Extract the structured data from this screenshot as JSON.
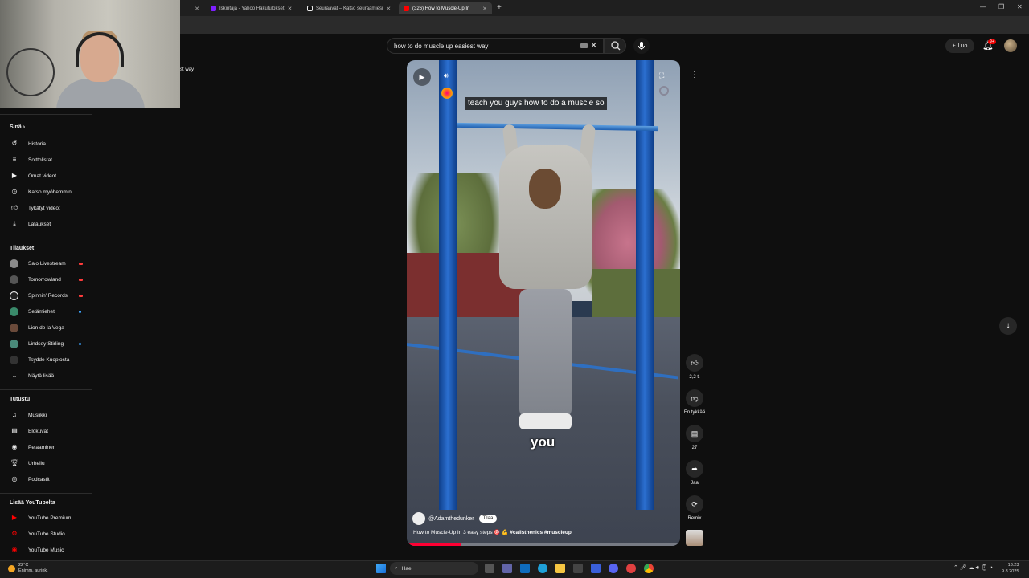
{
  "browser": {
    "tabs": [
      {
        "label": "...",
        "active": false
      },
      {
        "label": "Iskintäjä - Yahoo Hakutulokset",
        "active": false
      },
      {
        "label": "Seuraavat – Katso seuraamiesi",
        "active": false
      },
      {
        "label": "(326) How to Muscle-Up In",
        "active": true
      }
    ],
    "new_tab": "+"
  },
  "search": {
    "value": "how to do muscle up easiest way",
    "clear_label": "✕"
  },
  "header": {
    "create_label": "Luo",
    "notifications_badge": "9+"
  },
  "webcam_overlay_text": "st way",
  "sidebar": {
    "you_title": "Sinä",
    "you_items": [
      {
        "icon": "history-icon",
        "label": "Historia"
      },
      {
        "icon": "playlist-icon",
        "label": "Soittolistat"
      },
      {
        "icon": "your-videos-icon",
        "label": "Omat videot"
      },
      {
        "icon": "watch-later-icon",
        "label": "Katso myöhemmin"
      },
      {
        "icon": "liked-icon",
        "label": "Tykätyt videot"
      },
      {
        "icon": "download-icon",
        "label": "Lataukset"
      }
    ],
    "subs_title": "Tilaukset",
    "subs_items": [
      {
        "label": "Salo Livestream",
        "indicator": "live",
        "color": "#8a8a8a"
      },
      {
        "label": "Tomorrowland",
        "indicator": "live",
        "color": "#555"
      },
      {
        "label": "Spinnin' Records",
        "indicator": "live",
        "color": "#222"
      },
      {
        "label": "Setämiehet",
        "indicator": "dot",
        "color": "#3a8a6a"
      },
      {
        "label": "Lion de la Vega",
        "indicator": "",
        "color": "#6a4a3a"
      },
      {
        "label": "Lindsey Stirling",
        "indicator": "dot",
        "color": "#4a8a7a"
      },
      {
        "label": "Tsydde Kuopiosta",
        "indicator": "",
        "color": "#333"
      }
    ],
    "show_more": "Näytä lisää",
    "explore_title": "Tutustu",
    "explore_items": [
      {
        "icon": "music-icon",
        "label": "Musiikki"
      },
      {
        "icon": "movies-icon",
        "label": "Elokuvat"
      },
      {
        "icon": "gaming-icon",
        "label": "Pelaaminen"
      },
      {
        "icon": "sports-icon",
        "label": "Urheilu"
      },
      {
        "icon": "podcast-icon",
        "label": "Podcastit"
      }
    ],
    "more_title": "Lisää YouTubelta",
    "more_items": [
      {
        "label": "YouTube Premium",
        "color": "#ff0000"
      },
      {
        "label": "YouTube Studio",
        "color": "#ff0000"
      },
      {
        "label": "YouTube Music",
        "color": "#ff0000"
      }
    ]
  },
  "player": {
    "caption_top": "teach you guys how to do a muscle so",
    "caption_big": "you",
    "channel": "@Adamthedunker",
    "subscribe_label": "Tilaa",
    "title_prefix": "How to Muscle-Up In 3 easy steps 🎯 💪",
    "title_tags": "#calisthenics #muscleup",
    "progress": 0.2
  },
  "actions": {
    "like_count": "2,2 t.",
    "dislike_label": "En tykkää",
    "comments_count": "27",
    "share_label": "Jaa",
    "remix_label": "Remix"
  },
  "taskbar": {
    "weather_temp": "22°C",
    "weather_desc": "Enimm. aurink.",
    "search_placeholder": "Hae",
    "time": "13.23",
    "date": "9.8.2025"
  }
}
